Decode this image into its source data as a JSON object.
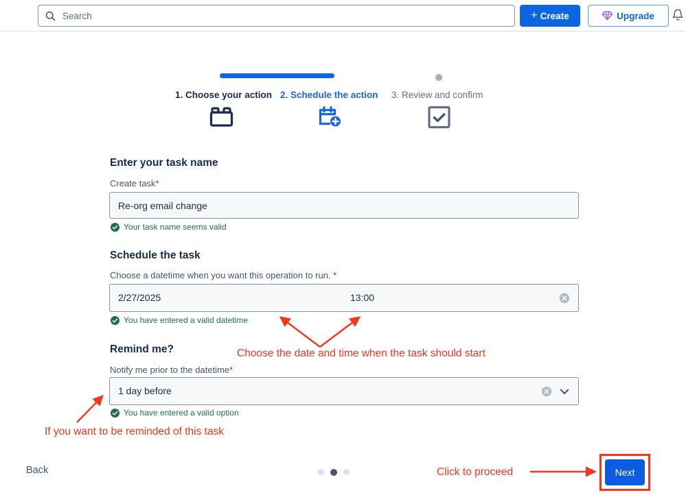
{
  "topbar": {
    "search_placeholder": "Search",
    "search_value": "",
    "search_icon": "search-icon",
    "create_label": "Create",
    "create_plus": "+",
    "upgrade_label": "Upgrade",
    "gem_icon": "gem-icon",
    "bell_icon": "bell-icon",
    "accent_blue": "#0c66e4",
    "upgrade_purple": "#a259e6"
  },
  "stepper": {
    "step1_label": "1. Choose your action",
    "step2_label": "2. Schedule the action",
    "step3_label": "3. Review and confirm",
    "step1_icon": "lego-brick-icon",
    "step2_icon": "calendar-plus-icon",
    "step3_icon": "checkbox-check-icon",
    "active_step": 2,
    "progress_color": "#0c66e4",
    "inactive_color": "#a5adba"
  },
  "form": {
    "task_section_title": "Enter your task name",
    "task_label": "Create task",
    "task_required": "*",
    "task_value": "Re-org email change",
    "task_valid_msg": "Your task name seems valid",
    "schedule_section_title": "Schedule the task",
    "datetime_label": "Choose a datetime when you want this operation to run.",
    "datetime_required": "*",
    "date_value": "2/27/2025",
    "time_value": "13:00",
    "datetime_valid_msg": "You have entered a valid datetime",
    "remind_section_title": "Remind me?",
    "notify_label": "Notify me prior to the datetime",
    "notify_required": "*",
    "notify_value": "1 day before",
    "notify_valid_msg": "You have entered a valid option",
    "clear_icon": "clear-circle-icon",
    "chevron_icon": "chevron-down-icon",
    "valid_icon": "check-circle-icon",
    "valid_color": "#216e4e",
    "required_color": "#ae2a19"
  },
  "footer": {
    "back_label": "Back",
    "next_label": "Next",
    "page_dots": 3,
    "active_dot": 2
  },
  "annotations": {
    "datetime_note": "Choose the date and time when the task should start",
    "remind_note": "If you want to be reminded of this task",
    "proceed_note": "Click to proceed",
    "color": "#f4361e"
  }
}
